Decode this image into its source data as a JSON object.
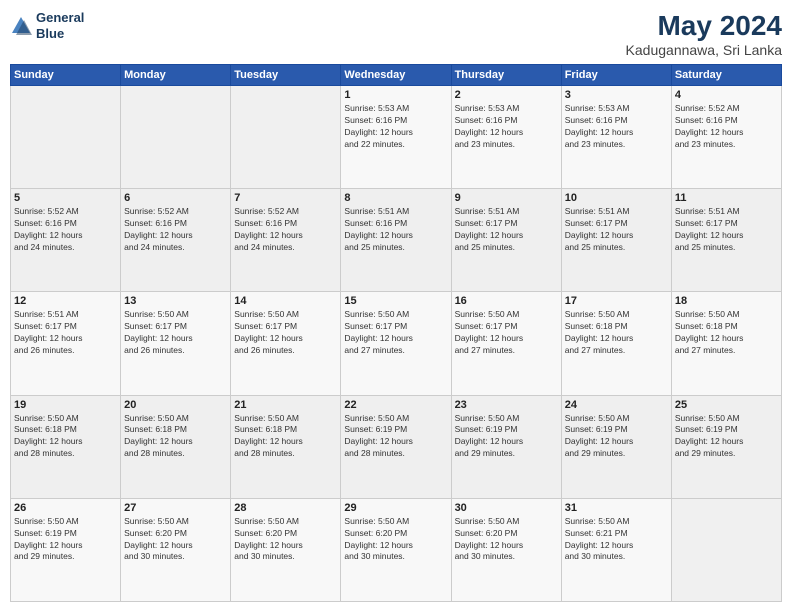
{
  "header": {
    "logo_line1": "General",
    "logo_line2": "Blue",
    "title": "May 2024",
    "subtitle": "Kadugannawa, Sri Lanka"
  },
  "weekdays": [
    "Sunday",
    "Monday",
    "Tuesday",
    "Wednesday",
    "Thursday",
    "Friday",
    "Saturday"
  ],
  "weeks": [
    [
      {
        "day": "",
        "info": ""
      },
      {
        "day": "",
        "info": ""
      },
      {
        "day": "",
        "info": ""
      },
      {
        "day": "1",
        "info": "Sunrise: 5:53 AM\nSunset: 6:16 PM\nDaylight: 12 hours\nand 22 minutes."
      },
      {
        "day": "2",
        "info": "Sunrise: 5:53 AM\nSunset: 6:16 PM\nDaylight: 12 hours\nand 23 minutes."
      },
      {
        "day": "3",
        "info": "Sunrise: 5:53 AM\nSunset: 6:16 PM\nDaylight: 12 hours\nand 23 minutes."
      },
      {
        "day": "4",
        "info": "Sunrise: 5:52 AM\nSunset: 6:16 PM\nDaylight: 12 hours\nand 23 minutes."
      }
    ],
    [
      {
        "day": "5",
        "info": "Sunrise: 5:52 AM\nSunset: 6:16 PM\nDaylight: 12 hours\nand 24 minutes."
      },
      {
        "day": "6",
        "info": "Sunrise: 5:52 AM\nSunset: 6:16 PM\nDaylight: 12 hours\nand 24 minutes."
      },
      {
        "day": "7",
        "info": "Sunrise: 5:52 AM\nSunset: 6:16 PM\nDaylight: 12 hours\nand 24 minutes."
      },
      {
        "day": "8",
        "info": "Sunrise: 5:51 AM\nSunset: 6:16 PM\nDaylight: 12 hours\nand 25 minutes."
      },
      {
        "day": "9",
        "info": "Sunrise: 5:51 AM\nSunset: 6:17 PM\nDaylight: 12 hours\nand 25 minutes."
      },
      {
        "day": "10",
        "info": "Sunrise: 5:51 AM\nSunset: 6:17 PM\nDaylight: 12 hours\nand 25 minutes."
      },
      {
        "day": "11",
        "info": "Sunrise: 5:51 AM\nSunset: 6:17 PM\nDaylight: 12 hours\nand 25 minutes."
      }
    ],
    [
      {
        "day": "12",
        "info": "Sunrise: 5:51 AM\nSunset: 6:17 PM\nDaylight: 12 hours\nand 26 minutes."
      },
      {
        "day": "13",
        "info": "Sunrise: 5:50 AM\nSunset: 6:17 PM\nDaylight: 12 hours\nand 26 minutes."
      },
      {
        "day": "14",
        "info": "Sunrise: 5:50 AM\nSunset: 6:17 PM\nDaylight: 12 hours\nand 26 minutes."
      },
      {
        "day": "15",
        "info": "Sunrise: 5:50 AM\nSunset: 6:17 PM\nDaylight: 12 hours\nand 27 minutes."
      },
      {
        "day": "16",
        "info": "Sunrise: 5:50 AM\nSunset: 6:17 PM\nDaylight: 12 hours\nand 27 minutes."
      },
      {
        "day": "17",
        "info": "Sunrise: 5:50 AM\nSunset: 6:18 PM\nDaylight: 12 hours\nand 27 minutes."
      },
      {
        "day": "18",
        "info": "Sunrise: 5:50 AM\nSunset: 6:18 PM\nDaylight: 12 hours\nand 27 minutes."
      }
    ],
    [
      {
        "day": "19",
        "info": "Sunrise: 5:50 AM\nSunset: 6:18 PM\nDaylight: 12 hours\nand 28 minutes."
      },
      {
        "day": "20",
        "info": "Sunrise: 5:50 AM\nSunset: 6:18 PM\nDaylight: 12 hours\nand 28 minutes."
      },
      {
        "day": "21",
        "info": "Sunrise: 5:50 AM\nSunset: 6:18 PM\nDaylight: 12 hours\nand 28 minutes."
      },
      {
        "day": "22",
        "info": "Sunrise: 5:50 AM\nSunset: 6:19 PM\nDaylight: 12 hours\nand 28 minutes."
      },
      {
        "day": "23",
        "info": "Sunrise: 5:50 AM\nSunset: 6:19 PM\nDaylight: 12 hours\nand 29 minutes."
      },
      {
        "day": "24",
        "info": "Sunrise: 5:50 AM\nSunset: 6:19 PM\nDaylight: 12 hours\nand 29 minutes."
      },
      {
        "day": "25",
        "info": "Sunrise: 5:50 AM\nSunset: 6:19 PM\nDaylight: 12 hours\nand 29 minutes."
      }
    ],
    [
      {
        "day": "26",
        "info": "Sunrise: 5:50 AM\nSunset: 6:19 PM\nDaylight: 12 hours\nand 29 minutes."
      },
      {
        "day": "27",
        "info": "Sunrise: 5:50 AM\nSunset: 6:20 PM\nDaylight: 12 hours\nand 30 minutes."
      },
      {
        "day": "28",
        "info": "Sunrise: 5:50 AM\nSunset: 6:20 PM\nDaylight: 12 hours\nand 30 minutes."
      },
      {
        "day": "29",
        "info": "Sunrise: 5:50 AM\nSunset: 6:20 PM\nDaylight: 12 hours\nand 30 minutes."
      },
      {
        "day": "30",
        "info": "Sunrise: 5:50 AM\nSunset: 6:20 PM\nDaylight: 12 hours\nand 30 minutes."
      },
      {
        "day": "31",
        "info": "Sunrise: 5:50 AM\nSunset: 6:21 PM\nDaylight: 12 hours\nand 30 minutes."
      },
      {
        "day": "",
        "info": ""
      }
    ]
  ]
}
